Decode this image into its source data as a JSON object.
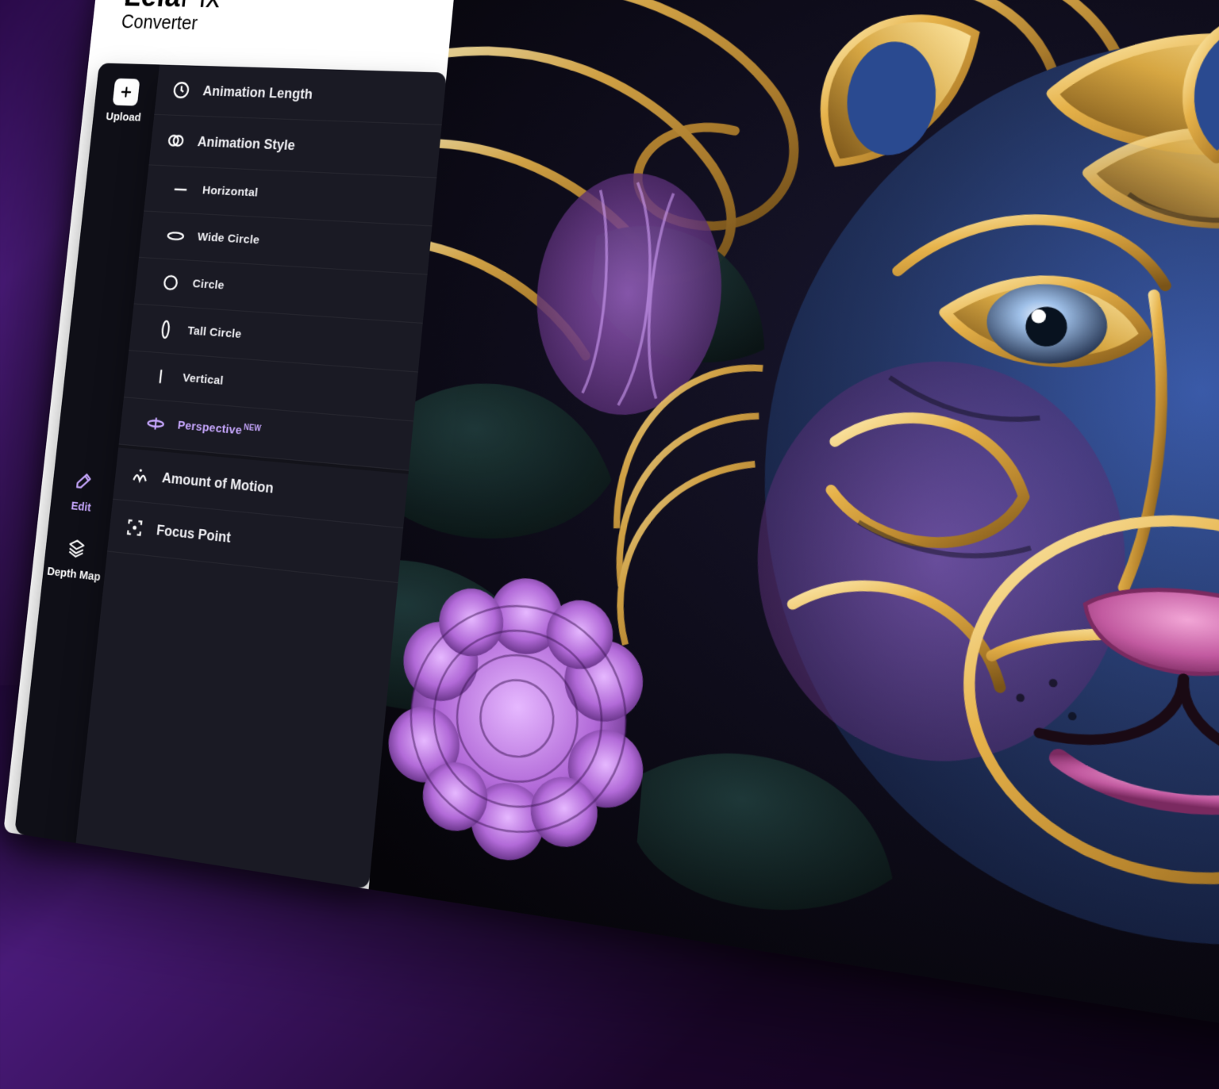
{
  "logo": {
    "brand_strong": "Leia",
    "brand_light": "Pix",
    "subtitle": "Converter"
  },
  "tabrail": {
    "upload": "Upload",
    "edit": "Edit",
    "depth": "Depth Map"
  },
  "menu": {
    "anim_length": "Animation Length",
    "anim_style": "Animation Style",
    "styles": {
      "horizontal": "Horizontal",
      "wide_circle": "Wide Circle",
      "circle": "Circle",
      "tall_circle": "Tall Circle",
      "vertical": "Vertical",
      "perspective": "Perspective",
      "perspective_badge": "NEW"
    },
    "amount_motion": "Amount of Motion",
    "focus_point": "Focus Point"
  },
  "preview": {
    "description": "Ornate stylized tiger artwork with gold filigree patterns, blue and purple hues, surrounded by dark foliage and a violet flower."
  }
}
